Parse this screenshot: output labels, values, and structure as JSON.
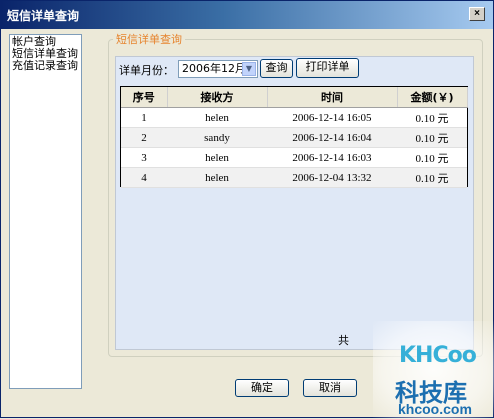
{
  "window": {
    "title": "短信详单查询",
    "close_label": "×"
  },
  "nav": {
    "items": [
      {
        "label": "帐户查询"
      },
      {
        "label": "短信详单查询"
      },
      {
        "label": "充值记录查询"
      }
    ]
  },
  "group": {
    "title": "短信详单查询"
  },
  "filter": {
    "month_label": "详单月份：",
    "month_value": "2006年12月",
    "query_label": "查询",
    "print_label": "打印详单"
  },
  "table": {
    "columns": [
      "序号",
      "接收方",
      "时间",
      "金额(￥)"
    ],
    "rows": [
      {
        "index": "1",
        "receiver": "helen",
        "time": "2006-12-14 16:05",
        "amount": "0.10 元"
      },
      {
        "index": "2",
        "receiver": "sandy",
        "time": "2006-12-14 16:04",
        "amount": "0.10 元"
      },
      {
        "index": "3",
        "receiver": "helen",
        "time": "2006-12-14 16:03",
        "amount": "0.10 元"
      },
      {
        "index": "4",
        "receiver": "helen",
        "time": "2006-12-04 13:32",
        "amount": "0.10 元"
      }
    ]
  },
  "footer": {
    "total_label": "共"
  },
  "buttons": {
    "ok_label": "确定",
    "cancel_label": "取消"
  },
  "watermark": {
    "logo": "KHCoo",
    "cn": "科技库",
    "domain": "khcoo.com"
  }
}
